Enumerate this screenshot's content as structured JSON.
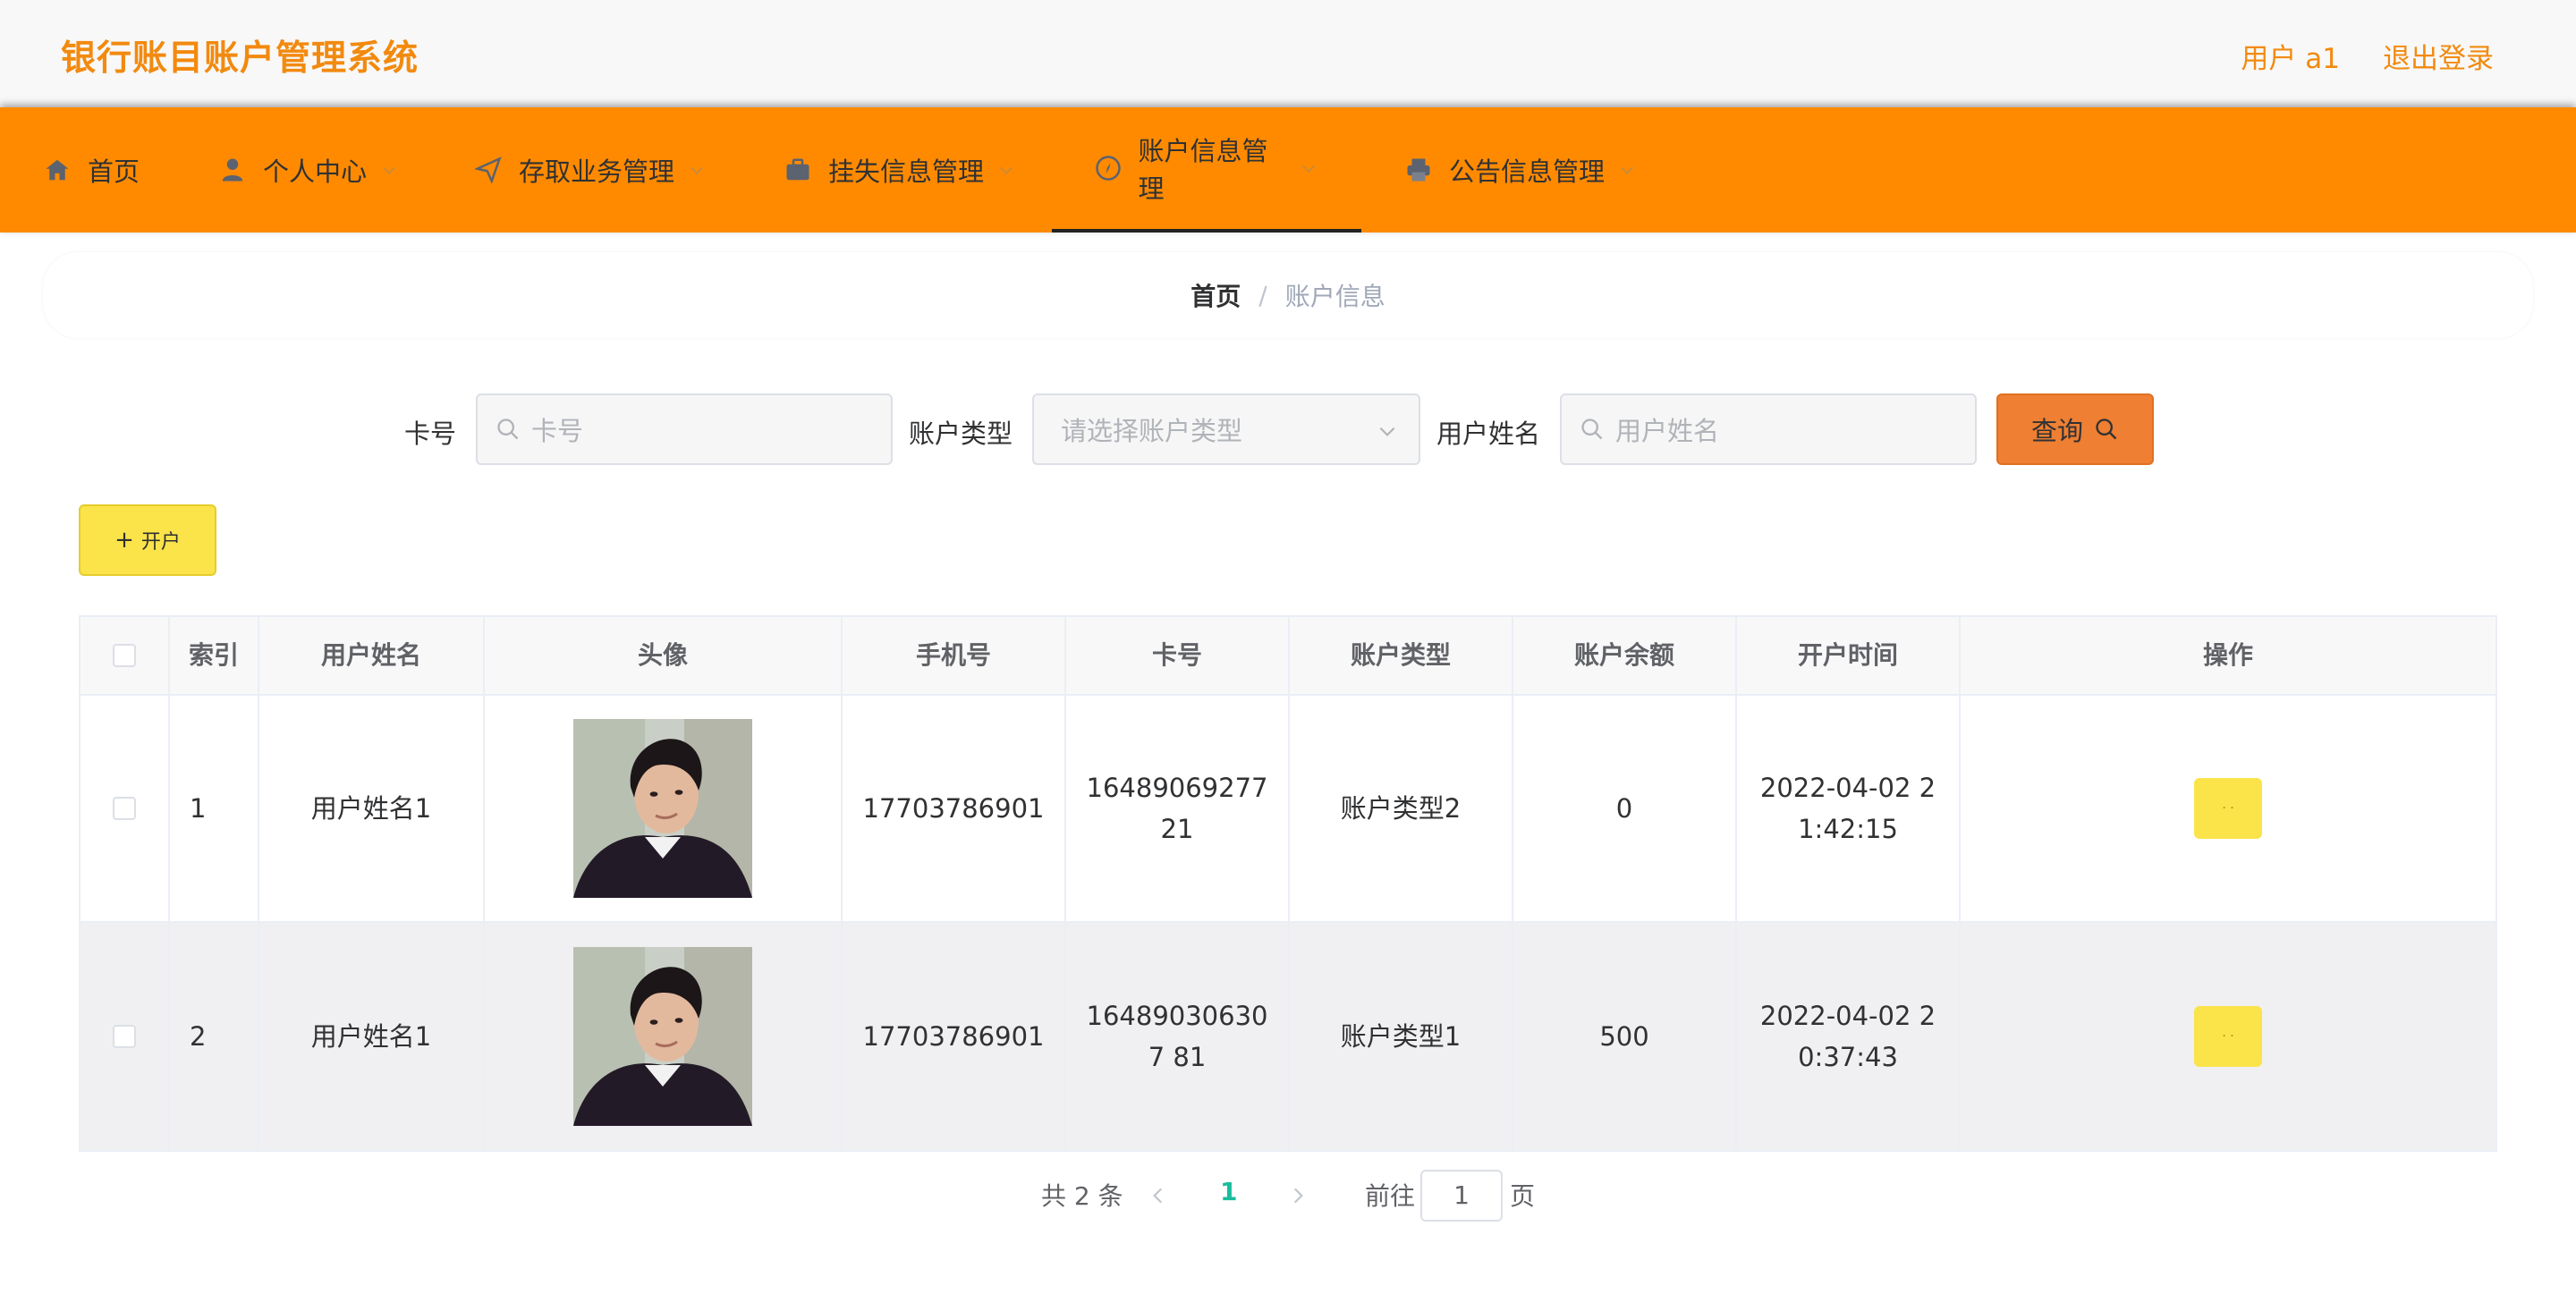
{
  "header": {
    "title": "银行账目账户管理系统",
    "user_label": "用户 a1",
    "logout_label": "退出登录",
    "accent_color": "#f28a0f"
  },
  "nav": {
    "bg_color": "#ff8a00",
    "items": [
      {
        "label": "首页",
        "icon": "home-icon"
      },
      {
        "label": "个人中心",
        "icon": "user-icon"
      },
      {
        "label": "存取业务管理",
        "icon": "send-icon"
      },
      {
        "label": "挂失信息管理",
        "icon": "briefcase-icon"
      },
      {
        "label": "账户信息管理",
        "icon": "compass-icon",
        "active": true
      },
      {
        "label": "公告信息管理",
        "icon": "printer-icon"
      }
    ]
  },
  "breadcrumb": {
    "home": "首页",
    "separator": "/",
    "current": "账户信息"
  },
  "search": {
    "card_label": "卡号",
    "card_placeholder": "卡号",
    "type_label": "账户类型",
    "type_placeholder": "请选择账户类型",
    "name_label": "用户姓名",
    "name_placeholder": "用户姓名",
    "query_label": "查询"
  },
  "actions": {
    "open_label": "开户"
  },
  "table": {
    "columns": [
      "索引",
      "用户姓名",
      "头像",
      "手机号",
      "卡号",
      "账户类型",
      "账户余额",
      "开户时间",
      "操作"
    ],
    "rows": [
      {
        "index": "1",
        "name": "用户姓名1",
        "phone": "17703786901",
        "card": "1648906927721",
        "type": "账户类型2",
        "balance": "0",
        "time": "2022-04-02 21:42:15",
        "op": "· ·"
      },
      {
        "index": "2",
        "name": "用户姓名1",
        "phone": "17703786901",
        "card": "164890306307 81",
        "type": "账户类型1",
        "balance": "500",
        "time": "2022-04-02 20:37:43",
        "op": "· ·"
      }
    ]
  },
  "pagination": {
    "total": "共 2 条",
    "current": "1",
    "goto_label": "前往",
    "goto_value": "1",
    "page_suffix": "页",
    "active_color": "#1abc9c"
  }
}
